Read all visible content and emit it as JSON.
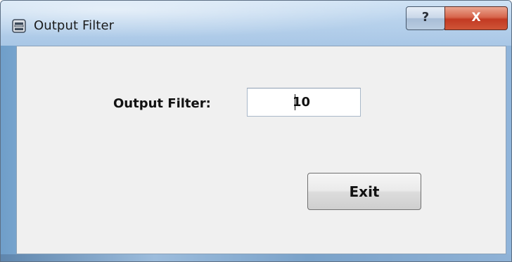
{
  "window": {
    "title": "Output Filter",
    "icon": "app-window-icon",
    "controls": {
      "help_label": "?",
      "close_label": "X"
    }
  },
  "form": {
    "filter_label": "Output Filter:",
    "filter_value": "10"
  },
  "actions": {
    "exit_label": "Exit"
  },
  "colors": {
    "close_button": "#c23a23",
    "client_background": "#f0f0f0",
    "titlebar": "#b8d2ec"
  }
}
